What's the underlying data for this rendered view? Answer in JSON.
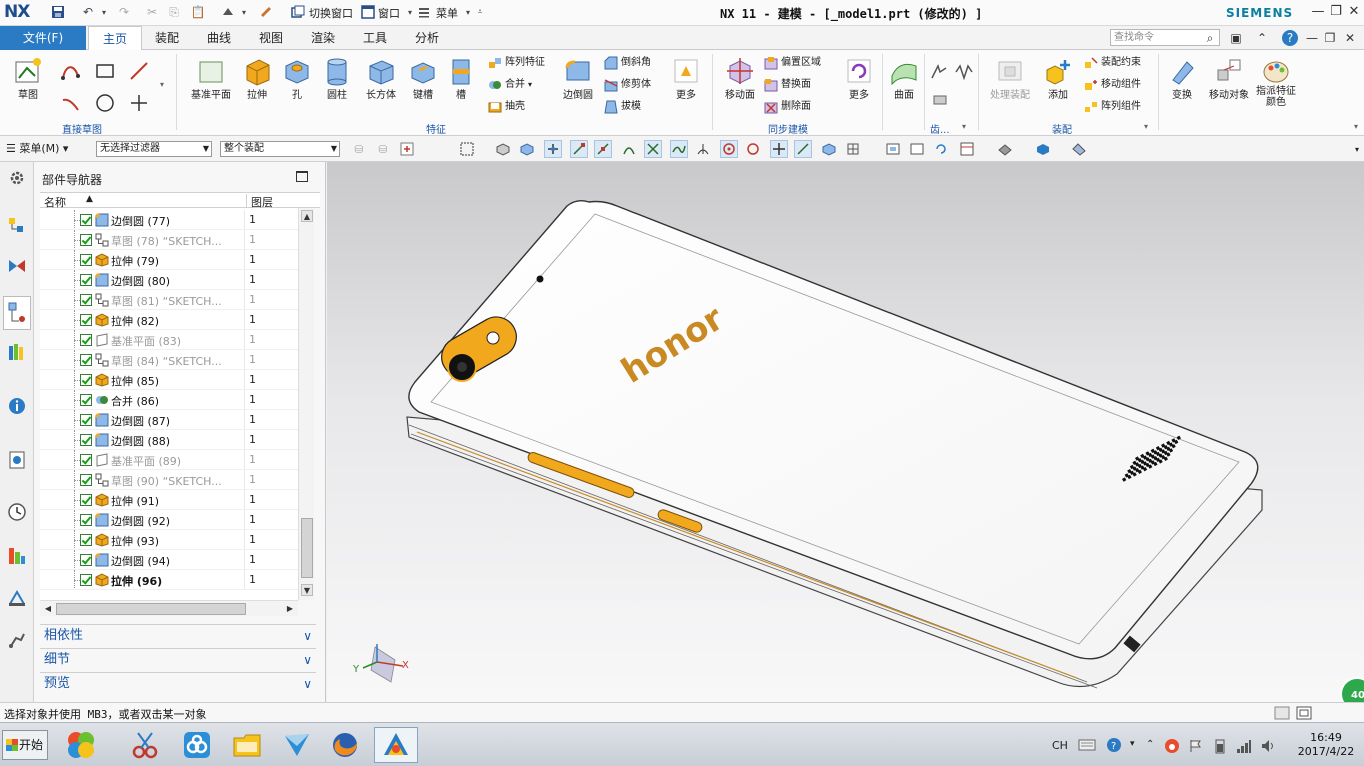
{
  "titlebar": {
    "logo": "NX",
    "switch_window": "切换窗口",
    "window_menu": "窗口",
    "menu": "菜单",
    "title": "NX 11 - 建模 - [_model1.prt  (修改的) ]",
    "brand": "SIEMENS"
  },
  "tabs": {
    "file": "文件(F)",
    "items": [
      "主页",
      "装配",
      "曲线",
      "视图",
      "渲染",
      "工具",
      "分析"
    ],
    "active": "主页",
    "search_placeholder": "查找命令"
  },
  "ribbon": {
    "sketch_group": {
      "label": "直接草图",
      "sketch": "草图"
    },
    "feature_group": {
      "label": "特征",
      "datum_plane": "基准平面",
      "extrude": "拉伸",
      "hole": "孔",
      "cylinder": "圆柱",
      "block": "长方体",
      "pocket": "键槽",
      "slot": "槽",
      "pattern_feature": "阵列特征",
      "unite": "合并",
      "shell": "抽壳",
      "edge_blend": "边倒圆",
      "chamfer": "倒斜角",
      "trim_body": "修剪体",
      "draft": "拔模",
      "more": "更多"
    },
    "sync_group": {
      "label": "同步建模",
      "move_face": "移动面",
      "offset_region": "偏置区域",
      "replace_face": "替换面",
      "delete_face": "删除面",
      "more": "更多"
    },
    "surface_group": {
      "surface": "曲面"
    },
    "other_group": {
      "label": "齿..."
    },
    "assembly_group": {
      "label": "装配",
      "process_assembly": "处理装配",
      "add": "添加",
      "assembly_constraints": "装配约束",
      "move_component": "移动组件",
      "pattern_component": "阵列组件"
    },
    "transform": "变换",
    "move_object": "移动对象",
    "color": "指派特征颜色"
  },
  "selbar": {
    "menu": "菜单(M)",
    "filter": "无选择过滤器",
    "scope": "整个装配"
  },
  "navigator": {
    "title": "部件导航器",
    "col_name": "名称",
    "col_layer": "图层",
    "rows": [
      {
        "name": "边倒圆  (77)",
        "layer": "1",
        "icon": "edge-blend",
        "dim": false,
        "bold": false
      },
      {
        "name": "草图  (78) “SKETCH...",
        "layer": "1",
        "icon": "sketch",
        "dim": true,
        "bold": false
      },
      {
        "name": "拉伸  (79)",
        "layer": "1",
        "icon": "extrude",
        "dim": false,
        "bold": false
      },
      {
        "name": "边倒圆  (80)",
        "layer": "1",
        "icon": "edge-blend",
        "dim": false,
        "bold": false
      },
      {
        "name": "草图  (81) “SKETCH...",
        "layer": "1",
        "icon": "sketch",
        "dim": true,
        "bold": false
      },
      {
        "name": "拉伸  (82)",
        "layer": "1",
        "icon": "extrude",
        "dim": false,
        "bold": false
      },
      {
        "name": "基准平面  (83)",
        "layer": "1",
        "icon": "datum",
        "dim": true,
        "bold": false
      },
      {
        "name": "草图  (84) “SKETCH...",
        "layer": "1",
        "icon": "sketch",
        "dim": true,
        "bold": false
      },
      {
        "name": "拉伸  (85)",
        "layer": "1",
        "icon": "extrude",
        "dim": false,
        "bold": false
      },
      {
        "name": "合并  (86)",
        "layer": "1",
        "icon": "unite",
        "dim": false,
        "bold": false
      },
      {
        "name": "边倒圆  (87)",
        "layer": "1",
        "icon": "edge-blend",
        "dim": false,
        "bold": false
      },
      {
        "name": "边倒圆  (88)",
        "layer": "1",
        "icon": "edge-blend",
        "dim": false,
        "bold": false
      },
      {
        "name": "基准平面  (89)",
        "layer": "1",
        "icon": "datum",
        "dim": true,
        "bold": false
      },
      {
        "name": "草图  (90) “SKETCH...",
        "layer": "1",
        "icon": "sketch",
        "dim": true,
        "bold": false
      },
      {
        "name": "拉伸  (91)",
        "layer": "1",
        "icon": "extrude",
        "dim": false,
        "bold": false
      },
      {
        "name": "边倒圆  (92)",
        "layer": "1",
        "icon": "edge-blend",
        "dim": false,
        "bold": false
      },
      {
        "name": "拉伸  (93)",
        "layer": "1",
        "icon": "extrude",
        "dim": false,
        "bold": false
      },
      {
        "name": "边倒圆  (94)",
        "layer": "1",
        "icon": "edge-blend",
        "dim": false,
        "bold": false
      },
      {
        "name": "拉伸  (96)",
        "layer": "1",
        "icon": "extrude",
        "dim": false,
        "bold": true
      }
    ],
    "panels": [
      "相依性",
      "细节",
      "预览"
    ]
  },
  "graphics": {
    "logo_text": "honor",
    "triad_x": "X",
    "triad_y": "Y",
    "badge": "40"
  },
  "status": {
    "message": "选择对象并使用 MB3，或者双击某一对象"
  },
  "taskbar": {
    "start": "开始",
    "ime": "CH",
    "time": "16:49",
    "date": "2017/4/22"
  },
  "colors": {
    "accent": "#2b7bc4",
    "accent_text": "#1a56a8",
    "brand": "#0a7fa0",
    "phone_body": "#ffffff",
    "phone_accent": "#f2a81d",
    "honor_logo": "#c98a24"
  }
}
